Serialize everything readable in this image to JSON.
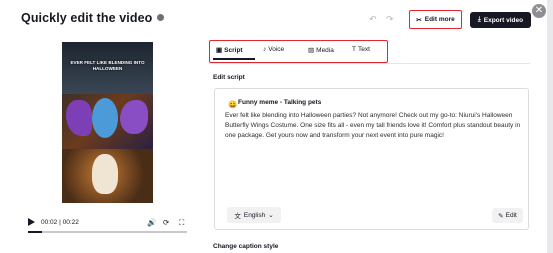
{
  "header": {
    "title": "Quickly edit the video",
    "edit_more_label": "Edit more",
    "export_label": "Export video",
    "undo_icon": "↶",
    "redo_icon": "↷",
    "close_icon": "✕"
  },
  "video": {
    "caption": "EVER FELT LIKE BLENDING INTO HALLOWEEN",
    "current_time": "00:02",
    "duration": "00:22",
    "progress_fraction": 0.09
  },
  "tabs": [
    {
      "label": "Script",
      "icon": "script-icon",
      "active": true
    },
    {
      "label": "Voice",
      "icon": "voice-icon",
      "active": false
    },
    {
      "label": "Media",
      "icon": "media-icon",
      "active": false
    },
    {
      "label": "Text",
      "icon": "text-icon",
      "active": false
    }
  ],
  "script": {
    "section_title": "Edit script",
    "emoji": "😀",
    "title": "Funny meme - Talking pets",
    "body": "Ever felt like blending into Halloween parties? Not anymore! Check out my go-to: Niurui's Halloween Butterfly Wings Costume. One size fits all - even my tall friends love it! Comfort plus standout beauty in one package. Get yours now and transform your next event into pure magic!",
    "language": "English",
    "edit_label": "Edit"
  },
  "next_section": {
    "title": "Change caption style"
  },
  "colors": {
    "accent_red": "#e0262f",
    "dark": "#161823"
  }
}
